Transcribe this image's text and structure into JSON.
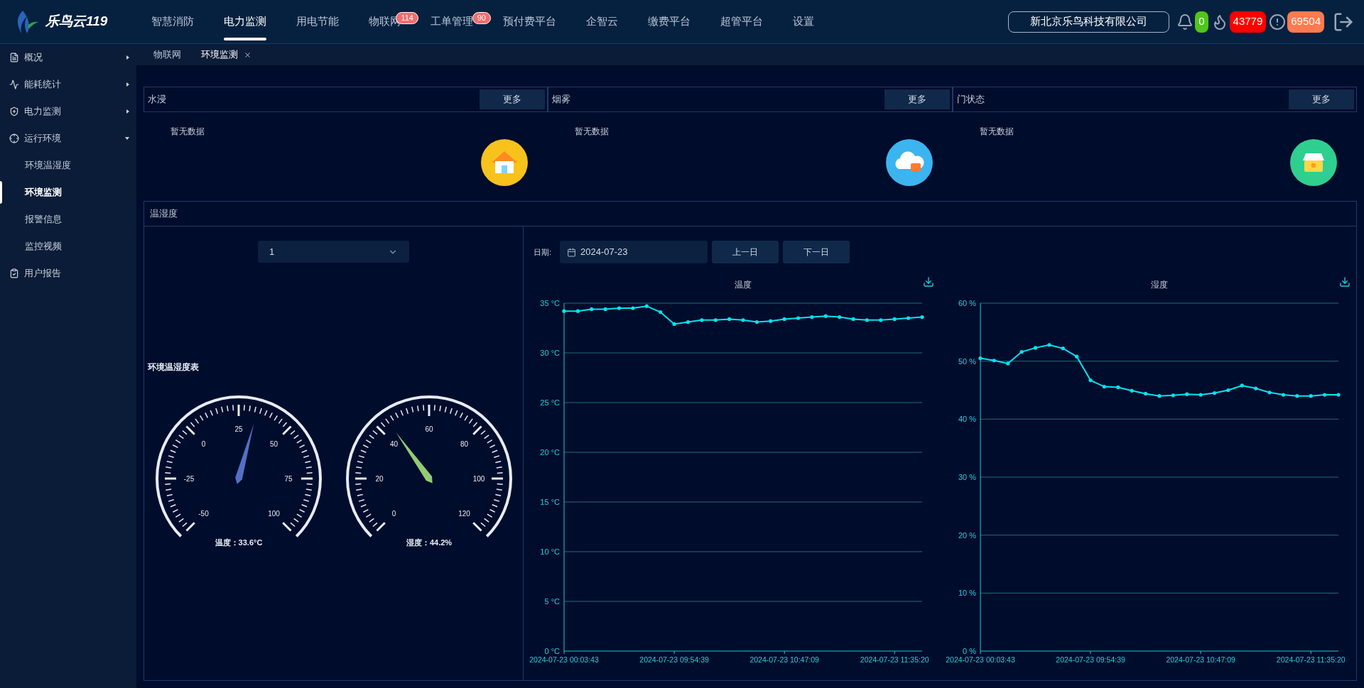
{
  "header": {
    "logo_text": "乐鸟云119",
    "nav": [
      {
        "label": "智慧消防",
        "selected": false
      },
      {
        "label": "电力监测",
        "selected": true
      },
      {
        "label": "用电节能",
        "selected": false
      },
      {
        "label": "物联网",
        "selected": false,
        "badge": "114"
      },
      {
        "label": "工单管理",
        "selected": false,
        "badge": "90"
      },
      {
        "label": "预付费平台",
        "selected": false
      },
      {
        "label": "企智云",
        "selected": false
      },
      {
        "label": "缴费平台",
        "selected": false
      },
      {
        "label": "超管平台",
        "selected": false
      },
      {
        "label": "设置",
        "selected": false
      }
    ],
    "company": "新北京乐鸟科技有限公司",
    "alerts": [
      {
        "kind": "bell",
        "count": "0",
        "color": "#52c41a"
      },
      {
        "kind": "fire",
        "count": "43779",
        "color": "#ff0000"
      },
      {
        "kind": "warning",
        "count": "69504",
        "color": "#ff7a50"
      }
    ]
  },
  "sidebar": {
    "items": [
      {
        "label": "概况",
        "kind": "document",
        "expanded": false
      },
      {
        "label": "能耗统计",
        "kind": "trend",
        "expanded": false
      },
      {
        "label": "电力监测",
        "kind": "shield",
        "expanded": false
      },
      {
        "label": "运行环境",
        "kind": "target",
        "expanded": true,
        "children": [
          {
            "label": "环境温湿度",
            "selected": false
          },
          {
            "label": "环境监测",
            "selected": true
          },
          {
            "label": "报警信息",
            "selected": false
          },
          {
            "label": "监控视频",
            "selected": false
          }
        ]
      },
      {
        "label": "用户报告",
        "kind": "clipboard"
      }
    ]
  },
  "tabs": [
    {
      "label": "物联网",
      "selected": false,
      "closable": false
    },
    {
      "label": "环境监测",
      "selected": true,
      "closable": true
    }
  ],
  "sensor_cards": [
    {
      "title": "水浸",
      "more": "更多",
      "empty": "暂无数据",
      "kind": "house",
      "color": "#f7c21b"
    },
    {
      "title": "烟雾",
      "more": "更多",
      "empty": "暂无数据",
      "kind": "cloud",
      "color": "#3cb4f0"
    },
    {
      "title": "门状态",
      "more": "更多",
      "empty": "暂无数据",
      "kind": "box",
      "color": "#2fcf8f"
    }
  ],
  "temp_humidity": {
    "title": "温湿度",
    "device_select": "1",
    "gauge_title": "环境温湿度表",
    "gauges": [
      {
        "ticks": [
          "-50",
          "-25",
          "0",
          "25",
          "50",
          "75",
          "100"
        ],
        "level": 0.557,
        "color": "#5470c6",
        "reading": "温度：33.6°C"
      },
      {
        "ticks": [
          "0",
          "20",
          "40",
          "60",
          "80",
          "100",
          "120"
        ],
        "level": 0.368,
        "color": "#91cc75",
        "reading": "湿度：44.2%"
      }
    ],
    "date_label": "日期:",
    "date": "2024-07-23",
    "prev_day": "上一日",
    "next_day": "下一日",
    "charts": [
      {
        "chart_data": {
          "type": "line",
          "title": "温度",
          "grid": true,
          "ylim": [
            0,
            35
          ],
          "categories": [
            "2024-07-23 00:03:43",
            null,
            null,
            null,
            null,
            null,
            null,
            null,
            "2024-07-23 09:54:39",
            null,
            null,
            null,
            null,
            null,
            null,
            null,
            "2024-07-23 10:47:09",
            null,
            null,
            null,
            null,
            null,
            null,
            null,
            "2024-07-23 11:35:20",
            null,
            null
          ],
          "yticks": [
            {
              "value": 0,
              "label": "0 °C"
            },
            {
              "value": 5,
              "label": "5 °C"
            },
            {
              "value": 10,
              "label": "10 °C"
            },
            {
              "value": 15,
              "label": "15 °C"
            },
            {
              "value": 20,
              "label": "20 °C"
            },
            {
              "value": 25,
              "label": "25 °C"
            },
            {
              "value": 30,
              "label": "30 °C"
            },
            {
              "value": 35,
              "label": "35 °C"
            }
          ],
          "series": [
            {
              "color": "#00e5f0",
              "values": [
                34.2,
                34.2,
                34.4,
                34.4,
                34.5,
                34.5,
                34.7,
                34.1,
                32.9,
                33.1,
                33.3,
                33.3,
                33.4,
                33.3,
                33.1,
                33.2,
                33.4,
                33.5,
                33.6,
                33.7,
                33.6,
                33.4,
                33.3,
                33.3,
                33.4,
                33.5,
                33.6
              ]
            }
          ]
        }
      },
      {
        "chart_data": {
          "type": "line",
          "title": "湿度",
          "grid": true,
          "ylim": [
            0,
            60
          ],
          "categories": [
            "2024-07-23 00:03:43",
            null,
            null,
            null,
            null,
            null,
            null,
            null,
            "2024-07-23 09:54:39",
            null,
            null,
            null,
            null,
            null,
            null,
            null,
            "2024-07-23 10:47:09",
            null,
            null,
            null,
            null,
            null,
            null,
            null,
            "2024-07-23 11:35:20",
            null,
            null
          ],
          "yticks": [
            {
              "value": 0,
              "label": "0 %"
            },
            {
              "value": 10,
              "label": "10 %"
            },
            {
              "value": 20,
              "label": "20 %"
            },
            {
              "value": 30,
              "label": "30 %"
            },
            {
              "value": 40,
              "label": "40 %"
            },
            {
              "value": 50,
              "label": "50 %"
            },
            {
              "value": 60,
              "label": "60 %"
            }
          ],
          "series": [
            {
              "color": "#00e5f0",
              "values": [
                50.5,
                50.1,
                49.6,
                51.6,
                52.3,
                52.8,
                52.2,
                50.8,
                46.7,
                45.6,
                45.5,
                44.9,
                44.4,
                44.0,
                44.1,
                44.3,
                44.2,
                44.5,
                45.0,
                45.8,
                45.3,
                44.6,
                44.2,
                44.0,
                44.0,
                44.2,
                44.2
              ]
            }
          ]
        }
      }
    ]
  }
}
